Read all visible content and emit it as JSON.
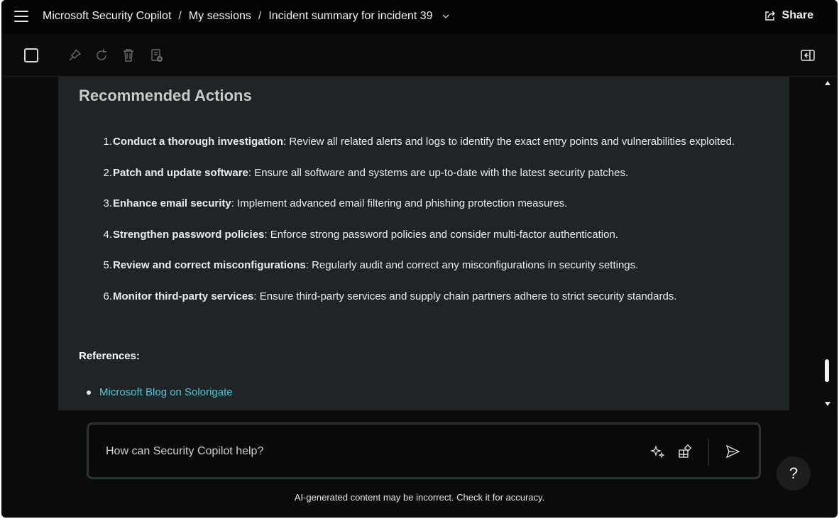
{
  "header": {
    "app_title": "Microsoft Security Copilot",
    "sep1": "/",
    "sessions": "My sessions",
    "sep2": "/",
    "session_title": "Incident summary for incident 39",
    "share_label": "Share"
  },
  "toolbar": {
    "icons": [
      "checkbox-icon",
      "pin-icon",
      "refresh-icon",
      "trash-icon",
      "export-pinboard-icon",
      "collapse-panel-icon"
    ]
  },
  "content": {
    "heading": "Recommended Actions",
    "actions": [
      {
        "num": "1.",
        "title": "Conduct a thorough investigation",
        "text": ": Review all related alerts and logs to identify the exact entry points and vulnerabilities exploited."
      },
      {
        "num": "2.",
        "title": "Patch and update software",
        "text": ": Ensure all software and systems are up-to-date with the latest security patches."
      },
      {
        "num": "3.",
        "title": "Enhance email security",
        "text": ": Implement advanced email filtering and phishing protection measures."
      },
      {
        "num": "4.",
        "title": "Strengthen password policies",
        "text": ": Enforce strong password policies and consider multi-factor authentication."
      },
      {
        "num": "5.",
        "title": "Review and correct misconfigurations",
        "text": ": Regularly audit and correct any misconfigurations in security settings."
      },
      {
        "num": "6.",
        "title": "Monitor third-party services",
        "text": ": Ensure third-party services and supply chain partners adhere to strict security standards."
      }
    ],
    "references_label": "References:",
    "references": [
      "Microsoft Blog on Solorigate"
    ]
  },
  "prompt": {
    "placeholder": "How can Security Copilot help?"
  },
  "help_label": "?",
  "disclaimer": "AI-generated content may be incorrect. Check it for accuracy.",
  "colors": {
    "background": "#0b0b0b",
    "content_panel": "#1f2526",
    "link": "#4fc7d6"
  }
}
